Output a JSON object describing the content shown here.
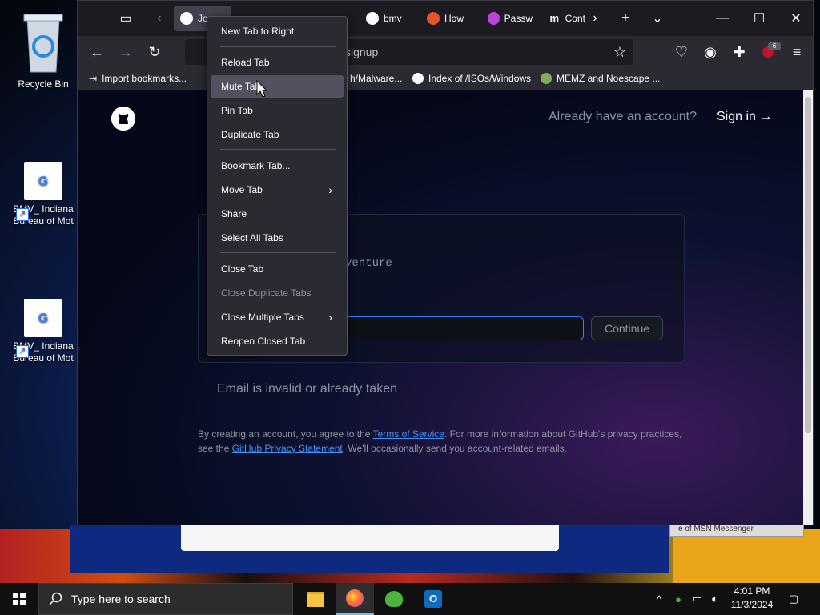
{
  "desktop": {
    "icons": [
      {
        "label": "Recycle Bin"
      },
      {
        "label": "BMV_ Indiana Bureau of Mot"
      },
      {
        "label": "BMV_ Indiana Bureau of Mot"
      }
    ]
  },
  "browser": {
    "tabs": [
      {
        "label": "Jo",
        "icon": "github-icon"
      },
      {
        "label": "bmv",
        "icon": "google-icon"
      },
      {
        "label": "How",
        "icon": "firefox-icon"
      },
      {
        "label": "Passw",
        "icon": "firefox-icon"
      },
      {
        "label": "Cont",
        "icon": "m-icon"
      }
    ],
    "url": "signup",
    "extension_badge": "6",
    "bookmarks": [
      {
        "label": "Import bookmarks..."
      },
      {
        "label": "h/Malware..."
      },
      {
        "label": "Index of /ISOs/Windows"
      },
      {
        "label": "MEMZ and Noescape ..."
      }
    ]
  },
  "context_menu": {
    "items": [
      {
        "label": "New Tab to Right",
        "disabled": false
      },
      {
        "label": "Reload Tab",
        "disabled": false
      },
      {
        "label": "Mute Tab",
        "disabled": false,
        "hover": true
      },
      {
        "label": "Pin Tab",
        "disabled": false
      },
      {
        "label": "Duplicate Tab",
        "disabled": false
      },
      {
        "label": "Bookmark Tab...",
        "disabled": false
      },
      {
        "label": "Move Tab",
        "disabled": false,
        "submenu": true
      },
      {
        "label": "Share",
        "disabled": false
      },
      {
        "label": "Select All Tabs",
        "disabled": false
      },
      {
        "label": "Close Tab",
        "disabled": false
      },
      {
        "label": "Close Duplicate Tabs",
        "disabled": true
      },
      {
        "label": "Close Multiple Tabs",
        "disabled": false,
        "submenu": true
      },
      {
        "label": "Reopen Closed Tab",
        "disabled": false
      }
    ]
  },
  "page": {
    "have_account": "Already have an account?",
    "signin": "Sign in →",
    "prompt_fragment": "venture",
    "continue": "Continue",
    "error": "Email is invalid or already taken",
    "legal_1": "By creating an account, you agree to the ",
    "terms": "Terms of Service",
    "legal_2": ". For more information about GitHub's privacy practices, see the ",
    "privacy": "GitHub Privacy Statement",
    "legal_3": ". We'll occasionally send you account-related emails."
  },
  "background_window": {
    "msn": "e of MSN Messenger"
  },
  "taskbar": {
    "search_placeholder": "Type here to search",
    "time": "4:01 PM",
    "date": "11/3/2024"
  }
}
